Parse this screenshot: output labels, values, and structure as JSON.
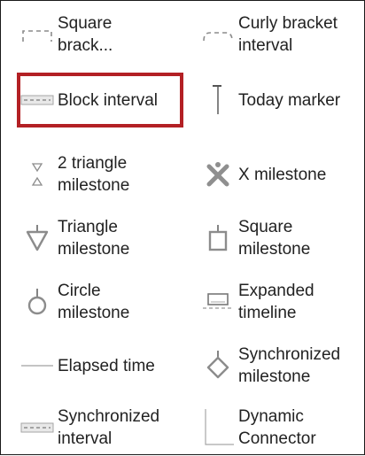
{
  "selected_item": "Block interval",
  "colors": {
    "selection_border": "#b32024",
    "icon_gray": "#9a9a9a",
    "text": "#222222"
  },
  "items": {
    "square_bracket": {
      "label": "Square\nbrack...",
      "icon": "square-bracket-interval-icon"
    },
    "curly_bracket": {
      "label": "Curly bracket\ninterval",
      "icon": "curly-bracket-interval-icon"
    },
    "block_interval": {
      "label": "Block interval",
      "icon": "block-interval-icon"
    },
    "today_marker": {
      "label": "Today marker",
      "icon": "today-marker-icon"
    },
    "two_triangle": {
      "label": "2 triangle\nmilestone",
      "icon": "two-triangle-milestone-icon"
    },
    "x_milestone": {
      "label": "X milestone",
      "icon": "x-milestone-icon"
    },
    "triangle_milestone": {
      "label": "Triangle\nmilestone",
      "icon": "triangle-milestone-icon"
    },
    "square_milestone": {
      "label": "Square\nmilestone",
      "icon": "square-milestone-icon"
    },
    "circle_milestone": {
      "label": "Circle\nmilestone",
      "icon": "circle-milestone-icon"
    },
    "expanded_timeline": {
      "label": "Expanded\ntimeline",
      "icon": "expanded-timeline-icon"
    },
    "elapsed_time": {
      "label": "Elapsed time",
      "icon": "elapsed-time-icon"
    },
    "synchronized_milestone": {
      "label": "Synchronized\nmilestone",
      "icon": "synchronized-milestone-icon"
    },
    "synchronized_interval": {
      "label": "Synchronized\ninterval",
      "icon": "synchronized-interval-icon"
    },
    "dynamic_connector": {
      "label": "Dynamic\nConnector",
      "icon": "dynamic-connector-icon"
    }
  }
}
